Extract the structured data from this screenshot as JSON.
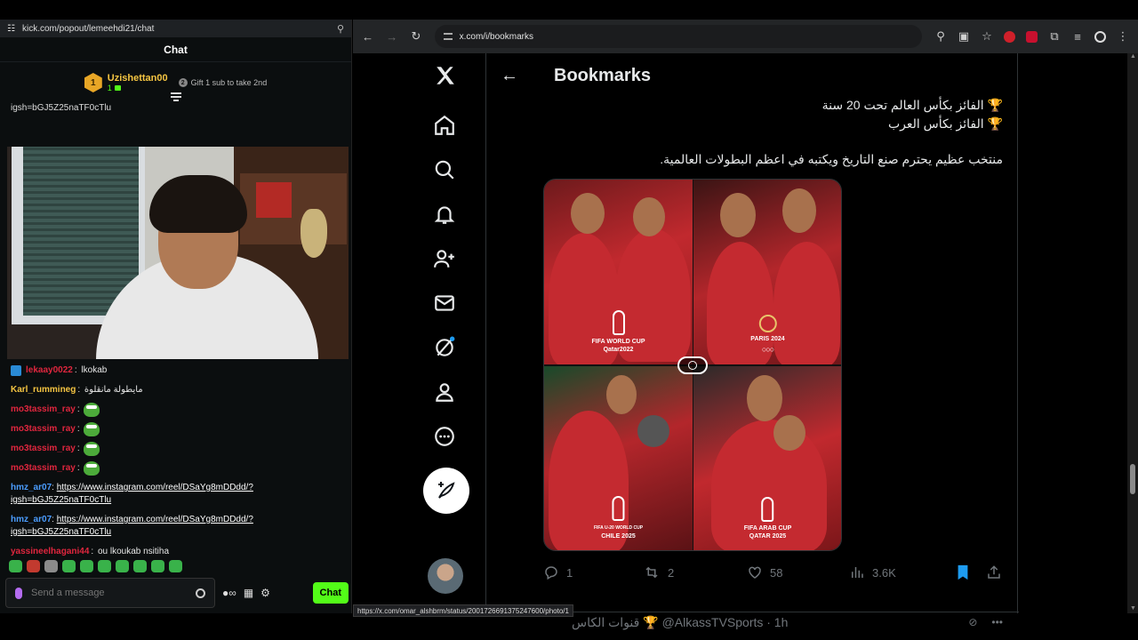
{
  "left": {
    "url": "kick.com/popout/lemeehdi21/chat",
    "chat_title": "Chat",
    "pinned": {
      "rank": "1",
      "username": "Uzishettan00",
      "count": "1",
      "gift_text": "Gift 1 sub to take 2nd"
    },
    "igsh_top": "igsh=bGJ5Z25naTF0cTlu",
    "messages": [
      {
        "user": "lekaay0022",
        "text": "lkokab"
      },
      {
        "user": "Karl_rummineg",
        "text": "مايطولة مانقلوة"
      },
      {
        "user": "mo3tassim_ray",
        "text": ""
      },
      {
        "user": "mo3tassim_ray",
        "text": ""
      },
      {
        "user": "mo3tassim_ray",
        "text": ""
      },
      {
        "user": "mo3tassim_ray",
        "text": ""
      },
      {
        "user": "hmz_ar07",
        "link": "https://www.instagram.com/reel/DSaYg8mDDdd/?",
        "link2": "igsh=bGJ5Z25naTF0cTlu"
      },
      {
        "user": "hmz_ar07",
        "link": "https://www.instagram.com/reel/DSaYg8mDDdd/?",
        "link2": "igsh=bGJ5Z25naTF0cTlu"
      },
      {
        "user": "yassineelhagani44",
        "text": "ou lkoukab nsitiha"
      }
    ],
    "input_placeholder": "Send a message",
    "chat_button": "Chat"
  },
  "browser": {
    "url": "x.com/i/bookmarks",
    "status_url": "https://x.com/omar_alshbrm/status/2001726691375247600/photo/1"
  },
  "x": {
    "header_title": "Bookmarks",
    "tweet": {
      "line1": "🏆 الفائز بكأس العالم تحت 20 سنة",
      "line2": "🏆 الفائز بكأس العرب",
      "line3": "منتخب عظيم يحترم صنع التاريخ ويكتبه في اعظم البطولات العالمية.",
      "tiles": [
        {
          "logo1": "FIFA WORLD CUP",
          "logo2": "Qatar2022"
        },
        {
          "logo1": "PARIS 2024",
          "logo2": ""
        },
        {
          "logo1": "FIFA U-20 WORLD CUP",
          "logo2": "CHILE 2025"
        },
        {
          "logo1": "FIFA ARAB CUP",
          "logo2": "QATAR 2025"
        }
      ],
      "replies": "1",
      "reposts": "2",
      "likes": "58",
      "views": "3.6K"
    },
    "next_tweet": "قنوات الكاس 🏆 @AlkassTVSports · 1h"
  },
  "colors": {
    "kick_green": "#53fc18",
    "x_blue": "#1d9bf0",
    "bg": "#000000"
  }
}
